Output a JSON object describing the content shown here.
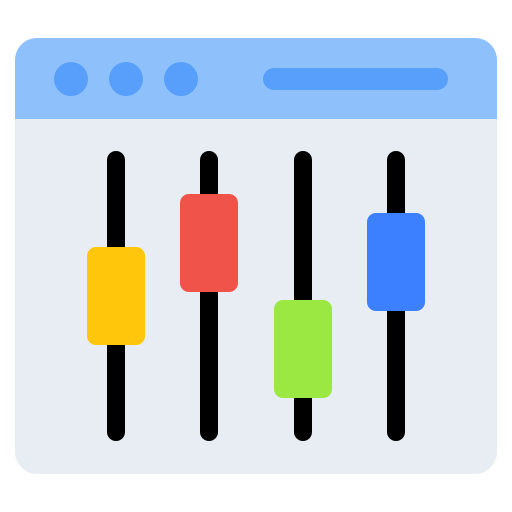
{
  "window": {
    "controls": [
      "close-icon",
      "minimize-icon",
      "maximize-icon"
    ]
  },
  "colors": {
    "titlebar": "#8ec1fb",
    "accent": "#579ffa",
    "body": "#e8edf4",
    "track": "#000000"
  },
  "sliders": [
    {
      "name": "slider-1",
      "value": 0.5,
      "color": "#ffc60b"
    },
    {
      "name": "slider-2",
      "value": 0.84,
      "color": "#f0534a"
    },
    {
      "name": "slider-3",
      "value": 0.16,
      "color": "#9be842"
    },
    {
      "name": "slider-4",
      "value": 0.72,
      "color": "#3d80ff"
    }
  ]
}
